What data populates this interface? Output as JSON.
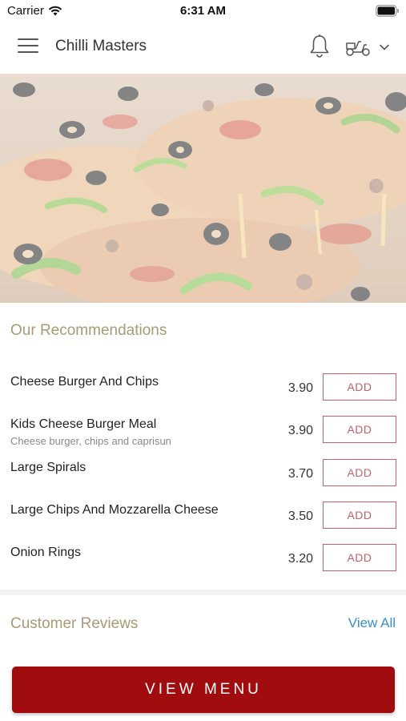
{
  "status_bar": {
    "carrier": "Carrier",
    "time": "6:31 AM"
  },
  "header": {
    "title": "Chilli Masters",
    "icons": [
      "hamburger-menu-icon",
      "bell-icon",
      "delivery-scooter-icon",
      "chevron-down-icon"
    ]
  },
  "recommendations": {
    "title": "Our Recommendations",
    "items": [
      {
        "name": "Cheese Burger And Chips",
        "description": "",
        "price": "3.90",
        "button": "ADD"
      },
      {
        "name": "Kids Cheese Burger Meal",
        "description": "Cheese burger, chips and caprisun",
        "price": "3.90",
        "button": "ADD"
      },
      {
        "name": "Large Spirals",
        "description": "",
        "price": "3.70",
        "button": "ADD"
      },
      {
        "name": "Large Chips And Mozzarella Cheese",
        "description": "",
        "price": "3.50",
        "button": "ADD"
      },
      {
        "name": "Onion Rings",
        "description": "",
        "price": "3.20",
        "button": "ADD"
      }
    ]
  },
  "reviews": {
    "title": "Customer Reviews",
    "view_all": "View All"
  },
  "footer": {
    "view_menu": "VIEW MENU"
  },
  "colors": {
    "accent_red": "#a10d0f",
    "add_button": "#c0646a",
    "section_title": "#a99a74",
    "link_blue": "#3a8fc4"
  }
}
